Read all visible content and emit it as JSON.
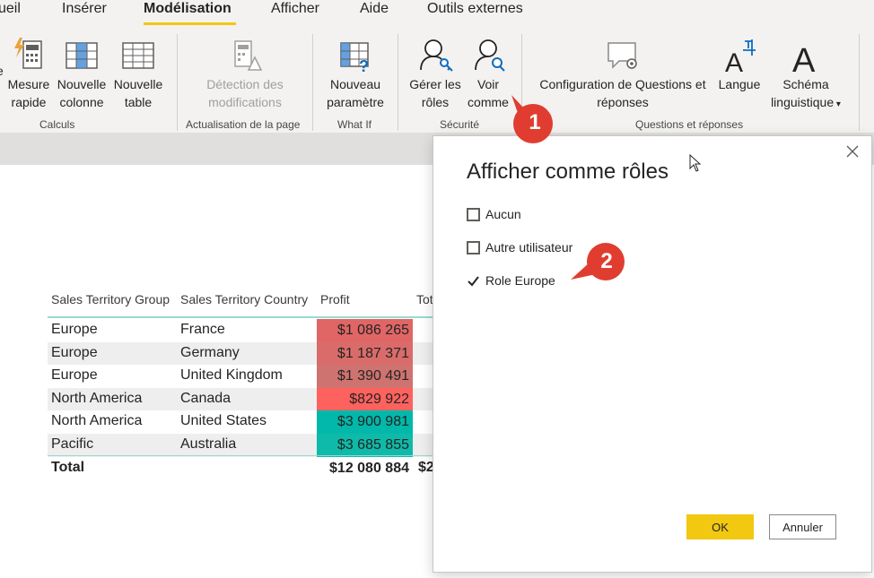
{
  "ribbon": {
    "tabs": [
      {
        "label": "ueil"
      },
      {
        "label": "Insérer"
      },
      {
        "label": "Modélisation"
      },
      {
        "label": "Afficher"
      },
      {
        "label": "Aide"
      },
      {
        "label": "Outils externes"
      }
    ],
    "active_tab": "Modélisation",
    "accent_color": "#f2c811",
    "buttons": {
      "measure": {
        "line1": "Mesure",
        "line2": "rapide"
      },
      "new_column": {
        "line1": "Nouvelle",
        "line2": "colonne"
      },
      "new_table": {
        "line1": "Nouvelle",
        "line2": "table"
      },
      "detect_changes": {
        "line1": "Détection des",
        "line2": "modifications"
      },
      "new_param": {
        "line1": "Nouveau",
        "line2": "paramètre"
      },
      "manage_roles": {
        "line1": "Gérer les",
        "line2": "rôles"
      },
      "view_as": {
        "line1": "Voir",
        "line2": "comme"
      },
      "qa_config": {
        "line1": "Configuration de Questions et",
        "line2": "réponses"
      },
      "language": {
        "line1": "Langue"
      },
      "schema": {
        "line1": "Schéma",
        "line2": "linguistique"
      }
    },
    "groups": {
      "calculs": "Calculs",
      "refresh": "Actualisation de la page",
      "whatif": "What If",
      "security": "Sécurité",
      "qa": "Questions et réponses"
    }
  },
  "table": {
    "headers": {
      "group": "Sales Territory Group",
      "country": "Sales Territory Country",
      "profit": "Profit",
      "total_partial": "Tot"
    },
    "rows": [
      {
        "group": "Europe",
        "country": "France",
        "profit": "$1 086 265",
        "color": "#e06666"
      },
      {
        "group": "Europe",
        "country": "Germany",
        "profit": "$1 187 371",
        "color": "#d96c6a"
      },
      {
        "group": "Europe",
        "country": "United Kingdom",
        "profit": "$1 390 491",
        "color": "#cf7370"
      },
      {
        "group": "North America",
        "country": "Canada",
        "profit": "$829 922",
        "color": "#fd625e"
      },
      {
        "group": "North America",
        "country": "United States",
        "profit": "$3 900 981",
        "color": "#01b8aa"
      },
      {
        "group": "Pacific",
        "country": "Australia",
        "profit": "$3 685 855",
        "color": "#0ebaa9"
      }
    ],
    "total": {
      "label": "Total",
      "profit": "$12 080 884",
      "partial": "$2"
    }
  },
  "dialog": {
    "title": "Afficher comme rôles",
    "options": [
      {
        "label": "Aucun",
        "checked": false
      },
      {
        "label": "Autre utilisateur",
        "checked": false
      },
      {
        "label": "Role Europe",
        "checked": true
      }
    ],
    "ok_label": "OK",
    "cancel_label": "Annuler"
  },
  "callouts": {
    "one": "1",
    "two": "2",
    "color": "#e03d30"
  }
}
